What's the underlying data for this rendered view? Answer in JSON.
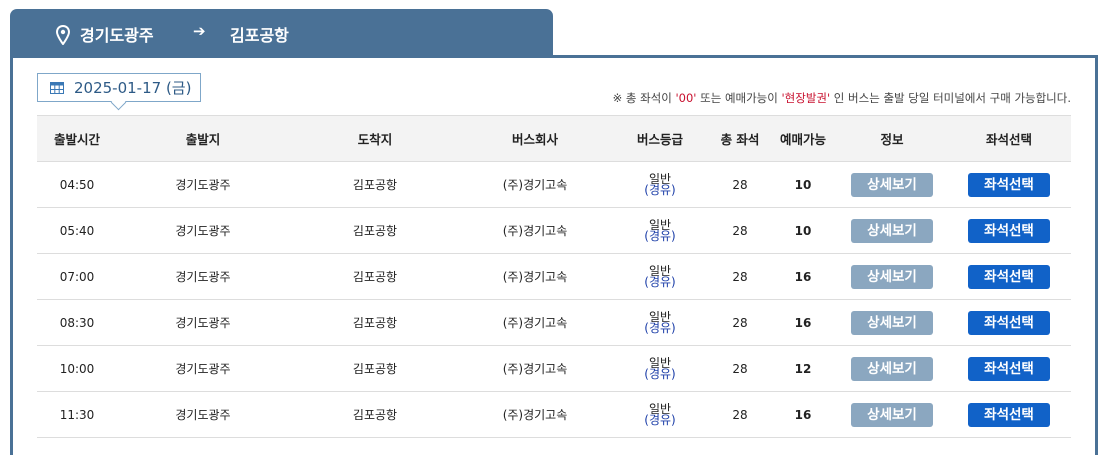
{
  "route": {
    "from": "경기도광주",
    "arrow": "➔",
    "to": "김포공항"
  },
  "date": {
    "label": "2025-01-17 (금)"
  },
  "notice": {
    "prefix": "※ 총 좌석이 ",
    "zero": "'00'",
    "middle": " 또는 예매가능이 ",
    "onsite": "'현장발권'",
    "suffix": " 인 버스는 출발 당일 터미널에서 구매 가능합니다."
  },
  "table": {
    "headers": [
      "출발시간",
      "출발지",
      "도착지",
      "버스회사",
      "버스등급",
      "총 좌석",
      "예매가능",
      "정보",
      "좌석선택"
    ],
    "rows": [
      {
        "time": "04:50",
        "from": "경기도광주",
        "to": "김포공항",
        "company": "(주)경기고속",
        "grade": "일반",
        "via": "(경유)",
        "total": "28",
        "avail": "10",
        "detail": "상세보기",
        "select": "좌석선택"
      },
      {
        "time": "05:40",
        "from": "경기도광주",
        "to": "김포공항",
        "company": "(주)경기고속",
        "grade": "일반",
        "via": "(경유)",
        "total": "28",
        "avail": "10",
        "detail": "상세보기",
        "select": "좌석선택"
      },
      {
        "time": "07:00",
        "from": "경기도광주",
        "to": "김포공항",
        "company": "(주)경기고속",
        "grade": "일반",
        "via": "(경유)",
        "total": "28",
        "avail": "16",
        "detail": "상세보기",
        "select": "좌석선택"
      },
      {
        "time": "08:30",
        "from": "경기도광주",
        "to": "김포공항",
        "company": "(주)경기고속",
        "grade": "일반",
        "via": "(경유)",
        "total": "28",
        "avail": "16",
        "detail": "상세보기",
        "select": "좌석선택"
      },
      {
        "time": "10:00",
        "from": "경기도광주",
        "to": "김포공항",
        "company": "(주)경기고속",
        "grade": "일반",
        "via": "(경유)",
        "total": "28",
        "avail": "12",
        "detail": "상세보기",
        "select": "좌석선택"
      },
      {
        "time": "11:30",
        "from": "경기도광주",
        "to": "김포공항",
        "company": "(주)경기고속",
        "grade": "일반",
        "via": "(경유)",
        "total": "28",
        "avail": "16",
        "detail": "상세보기",
        "select": "좌석선택"
      }
    ]
  },
  "colors": {
    "header_bar": "#4a7196",
    "select_button": "#1162c8",
    "detail_button": "#8ba7c0",
    "notice_red": "#c8102e"
  },
  "icons": {
    "location": "map-pin-icon",
    "direction": "arrow-right-icon",
    "calendar": "calendar-icon"
  }
}
